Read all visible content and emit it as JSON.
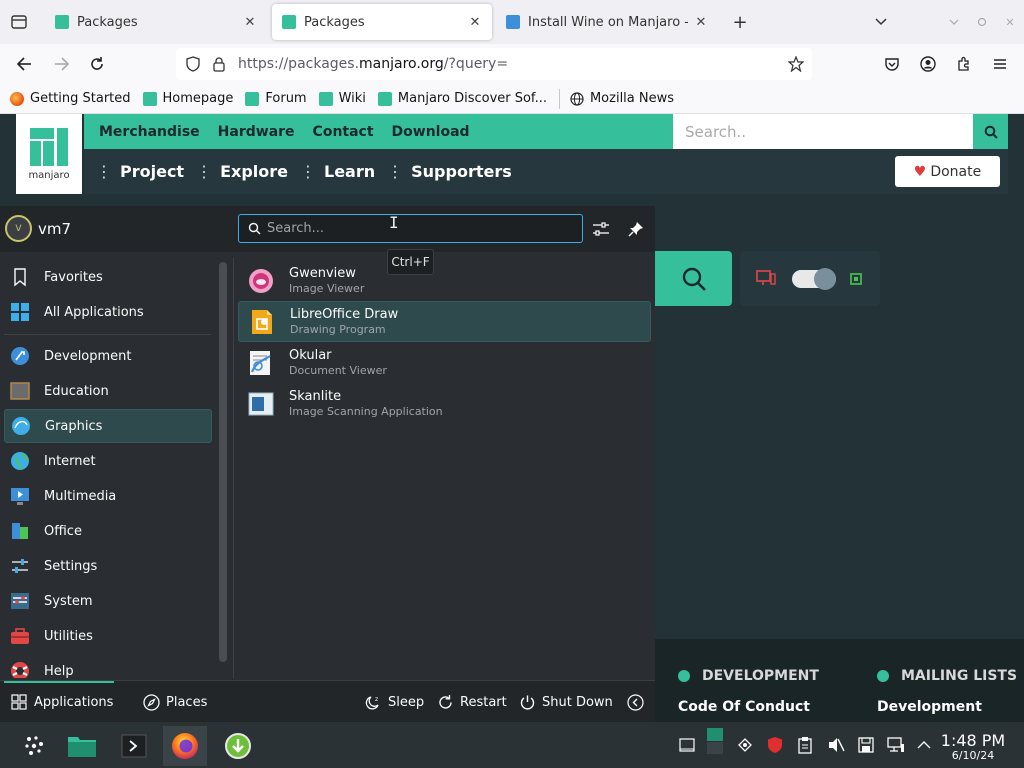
{
  "browser": {
    "tabs": [
      {
        "label": "Packages",
        "active": false
      },
      {
        "label": "Packages",
        "active": true
      },
      {
        "label": "Install Wine on Manjaro - ",
        "active": false
      }
    ],
    "url_prefix": "https://packages.",
    "url_domain": "manjaro.org",
    "url_suffix": "/?query=",
    "bookmarks": [
      "Getting Started",
      "Homepage",
      "Forum",
      "Wiki",
      "Manjaro Discover Sof...",
      "Mozilla News"
    ]
  },
  "site": {
    "logo_text": "manjaro",
    "top_menu": [
      "Merchandise",
      "Hardware",
      "Contact",
      "Download"
    ],
    "search_placeholder": "Search..",
    "main_menu": [
      "Project",
      "Explore",
      "Learn",
      "Supporters"
    ],
    "donate_label": "Donate",
    "footer": {
      "col1_heading": "DEVELOPMENT",
      "col1_link": "Code Of Conduct",
      "col2_heading": "MAILING LISTS",
      "col2_link": "Development"
    }
  },
  "launcher": {
    "username": "vm7",
    "avatar_letter": "V",
    "search_placeholder": "Search...",
    "tooltip": "Ctrl+F",
    "categories": [
      {
        "label": "Favorites",
        "icon": "bookmark-icon"
      },
      {
        "label": "All Applications",
        "icon": "grid-icon"
      },
      {
        "label": "Development",
        "icon": "development-icon"
      },
      {
        "label": "Education",
        "icon": "education-icon"
      },
      {
        "label": "Graphics",
        "icon": "graphics-icon",
        "selected": true
      },
      {
        "label": "Internet",
        "icon": "internet-icon"
      },
      {
        "label": "Multimedia",
        "icon": "multimedia-icon"
      },
      {
        "label": "Office",
        "icon": "office-icon"
      },
      {
        "label": "Settings",
        "icon": "settings-icon"
      },
      {
        "label": "System",
        "icon": "system-icon"
      },
      {
        "label": "Utilities",
        "icon": "utilities-icon"
      },
      {
        "label": "Help",
        "icon": "help-icon"
      }
    ],
    "results": [
      {
        "name": "Gwenview",
        "desc": "Image Viewer",
        "icon": "gwenview-icon"
      },
      {
        "name": "LibreOffice Draw",
        "desc": "Drawing Program",
        "icon": "libreoffice-draw-icon",
        "selected": true
      },
      {
        "name": "Okular",
        "desc": "Document Viewer",
        "icon": "okular-icon"
      },
      {
        "name": "Skanlite",
        "desc": "Image Scanning Application",
        "icon": "skanlite-icon"
      }
    ],
    "footer": {
      "applications": "Applications",
      "places": "Places",
      "sleep": "Sleep",
      "restart": "Restart",
      "shutdown": "Shut Down"
    }
  },
  "taskbar": {
    "time": "1:48 PM",
    "date": "6/10/24"
  },
  "colors": {
    "accent": "#35bf9b",
    "launcher_bg": "#2a2e32",
    "site_bg": "#223237",
    "selection": "#2f4a4c"
  }
}
